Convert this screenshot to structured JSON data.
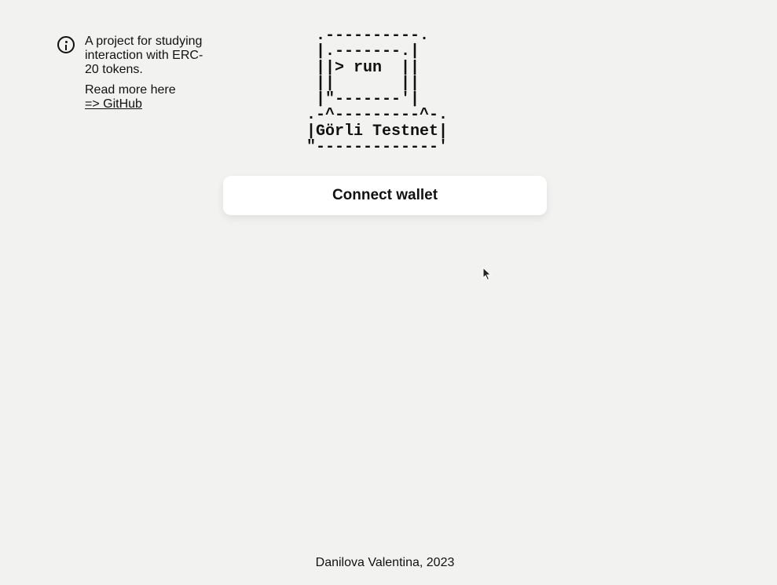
{
  "info": {
    "icon": "info-icon",
    "description": "A project for studying interaction with ERC-20 tokens.",
    "read_more": "Read more here",
    "link_label": "=> GitHub"
  },
  "logo": {
    "ascii_art": " .----------.\n |.-------.|\n ||> run  ||\n ||       ||\n |\"-------'|\n.-^---------^-.\n|Görli Testnet|\n\"-------------'"
  },
  "connect_button": {
    "label": "Connect wallet"
  },
  "footer": {
    "text": "Danilova Valentina, 2023"
  }
}
